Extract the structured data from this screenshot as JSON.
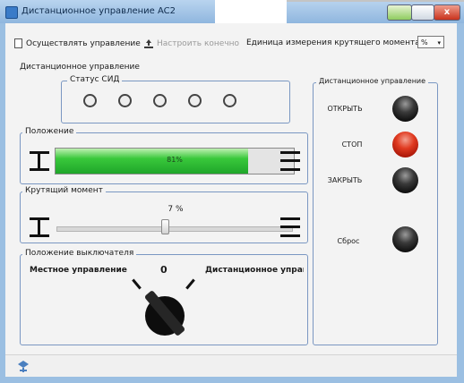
{
  "window": {
    "title": "Дистанционное управление AC2",
    "close_glyph": "x"
  },
  "toolbar": {
    "control_label": "Осуществлять управление",
    "configure_label": "Настроить конечно",
    "unit_caption": "Единица измерения крутящего момента",
    "unit_value": "%",
    "unit_arrow": "▾"
  },
  "remote": {
    "section_label": "Дистанционное управление",
    "led_group_label": "Статус СИД",
    "led_count": 5
  },
  "position": {
    "label": "Положение",
    "value_text": "81%",
    "fill_fraction": 0.81
  },
  "torque": {
    "label": "Крутящий момент",
    "value_text": "7 %",
    "slider_fraction": 0.46
  },
  "switch": {
    "label": "Положение выключателя",
    "local_label": "Местное управление",
    "center_label": "0",
    "remote_label": "Дистанционное управ"
  },
  "commands": {
    "group_label": "Дистанционное управление",
    "open_label": "ОТКРЫТЬ",
    "stop_label": "СТОП",
    "close_label": "ЗАКРЫТЬ",
    "reset_label": "Сброс"
  },
  "colors": {
    "title_bar": "#8fb6de",
    "group_border": "#7a97c2",
    "progress_green": "#39c83b",
    "stop_red": "#e03a20"
  }
}
